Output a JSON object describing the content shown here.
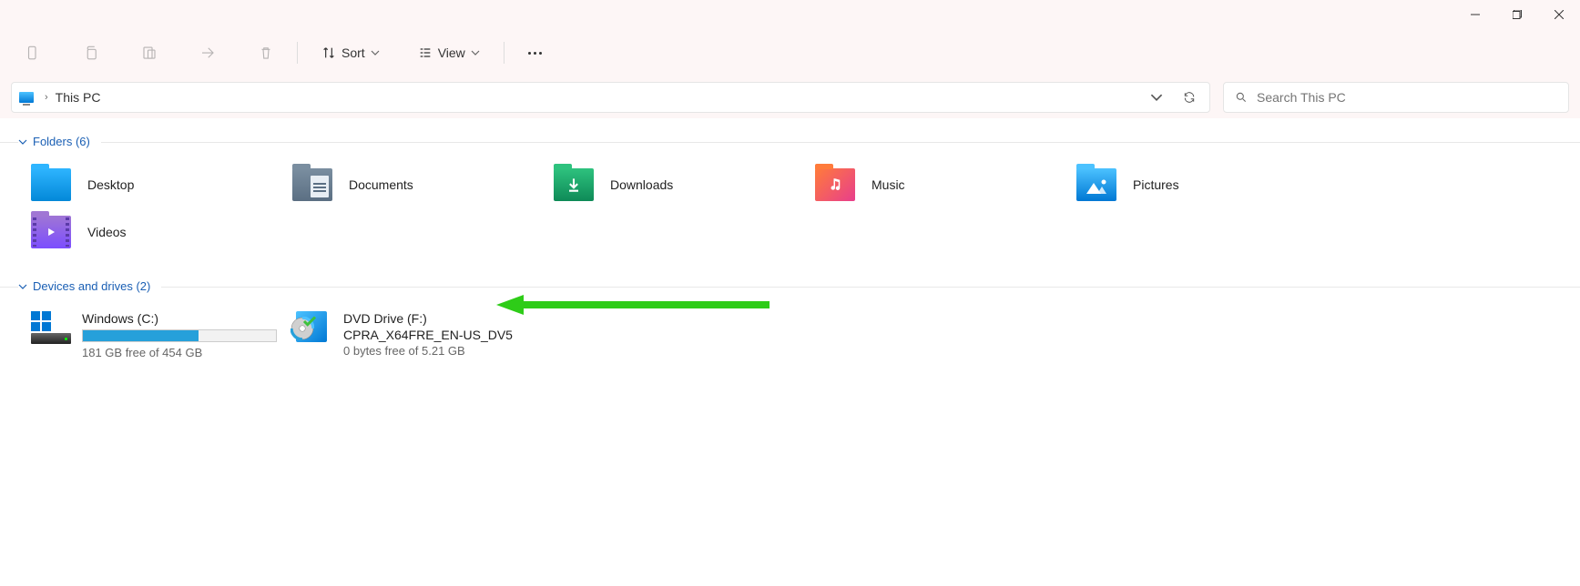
{
  "window_title": "This PC",
  "toolbar": {
    "sort_label": "Sort",
    "view_label": "View"
  },
  "breadcrumb": {
    "location": "This PC"
  },
  "search": {
    "placeholder": "Search This PC"
  },
  "groups": {
    "folders": {
      "title": "Folders (6)",
      "items": [
        {
          "label": "Desktop",
          "icon": "desktop",
          "bg": "linear-gradient(180deg,#2eb5ff 0%,#0388d8 100%)"
        },
        {
          "label": "Documents",
          "icon": "documents",
          "bg": "linear-gradient(180deg,#7a8ea0 0%,#5b6f83 100%)"
        },
        {
          "label": "Downloads",
          "icon": "downloads",
          "bg": "linear-gradient(180deg,#2ec27e 0%,#0e8a57 100%)"
        },
        {
          "label": "Music",
          "icon": "music",
          "bg": "linear-gradient(135deg,#ff7b3b 0%,#e83e8c 100%)"
        },
        {
          "label": "Pictures",
          "icon": "pictures",
          "bg": "linear-gradient(180deg,#4cc2ff 0%,#0078d4 100%)"
        },
        {
          "label": "Videos",
          "icon": "videos",
          "bg": "linear-gradient(180deg,#a076d4 0%,#7c4dff 100%)"
        }
      ]
    },
    "drives": {
      "title": "Devices and drives (2)",
      "items": [
        {
          "name": "Windows (C:)",
          "free_text": "181 GB free of 454 GB",
          "used_percent": 60,
          "icon": "disk"
        },
        {
          "name": "DVD Drive (F:)",
          "sub": "CPRA_X64FRE_EN-US_DV5",
          "free_text": "0 bytes free of 5.21 GB",
          "icon": "dvd"
        }
      ]
    }
  }
}
